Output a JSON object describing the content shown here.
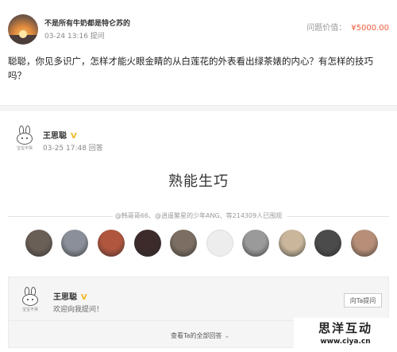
{
  "question": {
    "asker_name": "不是所有牛奶都是特仑苏的",
    "time": "03-24 13:16 提问",
    "price_label": "问题价值：",
    "price_value": "¥5000.00",
    "text": "聪聪，你见多识广，怎样才能火眼金睛的从白莲花的外表看出绿茶婊的内心？有怎样的技巧吗？"
  },
  "answer": {
    "avatar_tag": "宝宝不哭",
    "answerer_name": "王思聪",
    "verified_icon": "verified-v-icon",
    "time": "03-25 17:48 回答",
    "content": "熟能生巧"
  },
  "viewers": {
    "text": "@韩哥哥66、@逍遥繁星的少年ANG、等214309人已围观",
    "avatars": [
      {
        "name": "viewer-1",
        "color": "#6a5f57"
      },
      {
        "name": "viewer-2",
        "color": "#8a8f99"
      },
      {
        "name": "viewer-3",
        "color": "#b0553e"
      },
      {
        "name": "viewer-4",
        "color": "#3d2b2b"
      },
      {
        "name": "viewer-5",
        "color": "#7c6e62"
      },
      {
        "name": "viewer-6",
        "color": "#e9e9e9"
      },
      {
        "name": "viewer-7",
        "color": "#9a9a9a"
      },
      {
        "name": "viewer-8",
        "color": "#c9b69b"
      },
      {
        "name": "viewer-9",
        "color": "#4b4b4b"
      },
      {
        "name": "viewer-10",
        "color": "#b78f78"
      }
    ]
  },
  "follow": {
    "name": "王思聪",
    "welcome": "欢迎向我提问！",
    "ask_button": "向Ta提问",
    "all_answers": "查看Ta的全部回答"
  },
  "watermark": {
    "cn": "思洋互动",
    "url": "www.ciya.cn"
  },
  "colors": {
    "price": "#f25a3a",
    "verified": "#f3b81f"
  }
}
